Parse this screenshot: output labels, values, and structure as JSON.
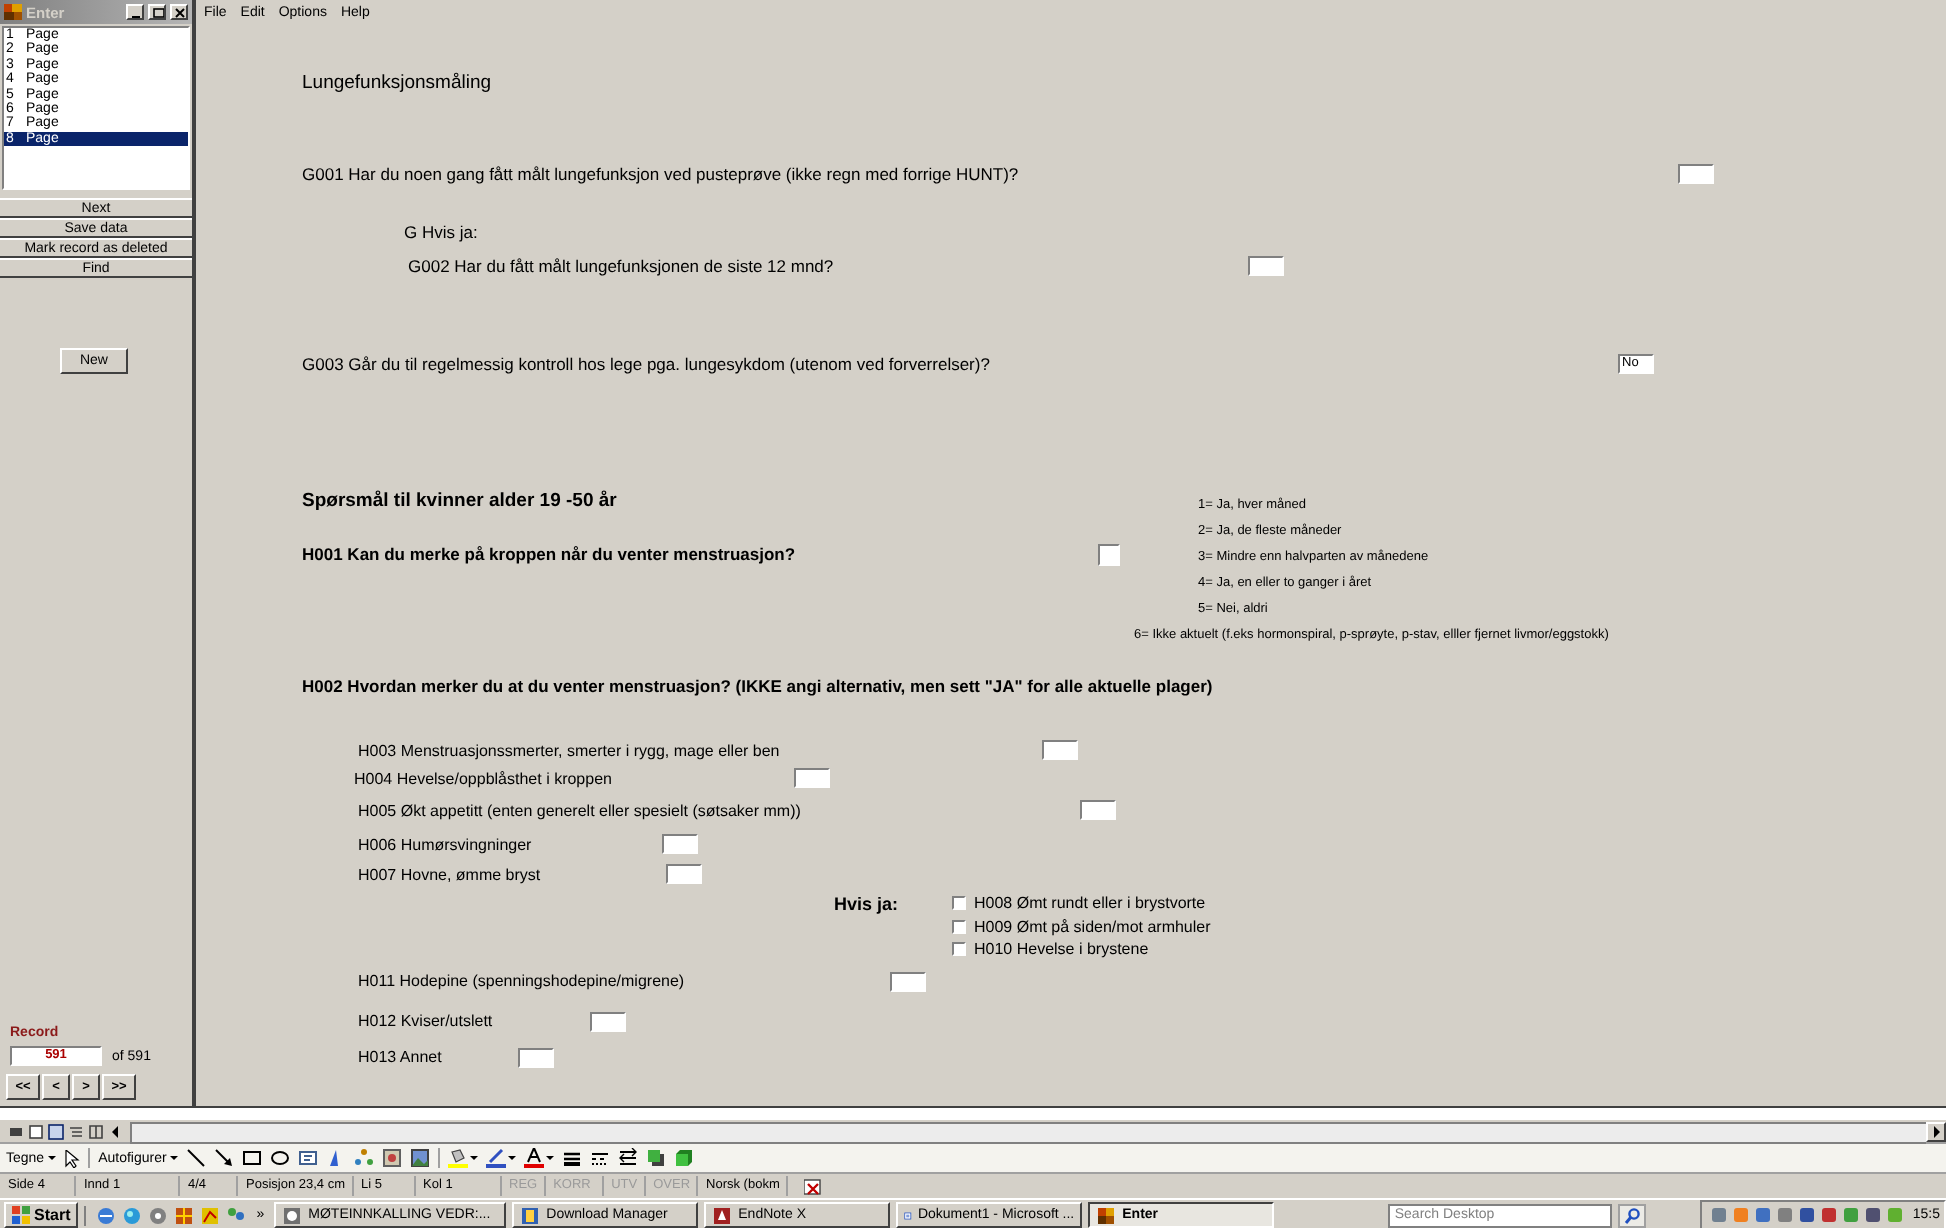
{
  "sidebar": {
    "title": "Enter",
    "pages": [
      {
        "number": "1",
        "label": "Page",
        "selected": false
      },
      {
        "number": "2",
        "label": "Page",
        "selected": false
      },
      {
        "number": "3",
        "label": "Page",
        "selected": false
      },
      {
        "number": "4",
        "label": "Page",
        "selected": false
      },
      {
        "number": "5",
        "label": "Page",
        "selected": false
      },
      {
        "number": "6",
        "label": "Page",
        "selected": false
      },
      {
        "number": "7",
        "label": "Page",
        "selected": false
      },
      {
        "number": "8",
        "label": "Page",
        "selected": true
      }
    ],
    "buttons": [
      "Next",
      "Save data",
      "Mark record as deleted",
      "Find"
    ],
    "new_button": "New",
    "record": {
      "label": "Record",
      "value": "591",
      "total": "of 591",
      "nav": [
        "<<",
        "<",
        ">",
        ">>"
      ]
    }
  },
  "menu": [
    "File",
    "Edit",
    "Options",
    "Help"
  ],
  "form": {
    "items": [
      {
        "kind": "title",
        "text": "Lungefunksjonsmåling"
      },
      {
        "kind": "field",
        "text": "G001 Har du noen gang fått målt lungefunksjon ved pusteprøve (ikke regn med forrige HUNT)?"
      },
      {
        "kind": "label",
        "text": "G Hvis ja:"
      },
      {
        "kind": "field",
        "text": "G002 Har du fått målt lungefunksjonen de siste 12 mnd?"
      },
      {
        "kind": "field",
        "text": "G003 Går du til regelmessig kontroll hos lege pga. lungesykdom (utenom ved forverrelser)?",
        "value": "No"
      },
      {
        "kind": "section",
        "heading": "Spørsmål til kvinner alder 19 -50 år",
        "question": {
          "text": "H001 Kan du merke på kroppen når du venter menstruasjon?",
          "checked": false
        },
        "legend": [
          "1= Ja, hver måned",
          "2= Ja, de fleste måneder",
          "3= Mindre enn halvparten av månedene",
          "4= Ja, en eller to ganger i året",
          "5= Nei, aldri",
          "6= Ikke aktuelt (f.eks hormonspiral, p-sprøyte, p-stav, elller fjernet livmor/eggstokk)"
        ]
      },
      {
        "kind": "subheading",
        "text": "H002 Hvordan merker du at du venter menstruasjon? (IKKE angi alternativ, men sett \"JA\" for alle aktuelle plager)"
      },
      {
        "kind": "field",
        "text": "H003 Menstruasjonssmerter, smerter i rygg, mage eller ben"
      },
      {
        "kind": "field",
        "text": "H004 Hevelse/oppblåsthet i kroppen"
      },
      {
        "kind": "field",
        "text": "H005 Økt appetitt (enten generelt eller spesielt (søtsaker mm))"
      },
      {
        "kind": "field",
        "text": "H006 Humørsvingninger"
      },
      {
        "kind": "field",
        "text": "H007 Hovne, ømme bryst"
      },
      {
        "kind": "checkgroup",
        "label": "Hvis ja:",
        "options": [
          {
            "text": "H008 Ømt rundt eller i brystvorte",
            "checked": false
          },
          {
            "text": "H009 Ømt på siden/mot armhuler",
            "checked": false
          },
          {
            "text": "H010 Hevelse i brystene",
            "checked": false
          }
        ]
      },
      {
        "kind": "field",
        "text": "H011 Hodepine (spenningshodepine/migrene)"
      },
      {
        "kind": "field",
        "text": "H012 Kviser/utslett"
      },
      {
        "kind": "field",
        "text": "H013 Annet"
      }
    ]
  },
  "drawing_toolbar": {
    "draw_menu": "Tegne",
    "autoshapes_menu": "Autofigurer"
  },
  "status_bar": [
    {
      "text": "Side 4",
      "disabled": false
    },
    {
      "text": "Innd 1",
      "disabled": false
    },
    {
      "text": "4/4",
      "disabled": false
    },
    {
      "text": "Posisjon 23,4 cm",
      "disabled": false
    },
    {
      "text": "Li 5",
      "disabled": false
    },
    {
      "text": "Kol 1",
      "disabled": false
    },
    {
      "text": "REG",
      "disabled": true
    },
    {
      "text": "KORR",
      "disabled": true
    },
    {
      "text": "UTV",
      "disabled": true
    },
    {
      "text": "OVER",
      "disabled": true
    },
    {
      "text": "Norsk (bokm",
      "disabled": false
    }
  ],
  "taskbar": {
    "start": "Start",
    "more": "»",
    "tasks": [
      {
        "label": "MØTEINNKALLING VEDR:...",
        "selected": false
      },
      {
        "label": "Download Manager",
        "selected": false
      },
      {
        "label": "EndNote X",
        "selected": false
      },
      {
        "label": "Dokument1 - Microsoft ...",
        "selected": false
      },
      {
        "label": "Enter",
        "selected": true
      }
    ],
    "search": {
      "placeholder": "Search Desktop"
    },
    "clock": "15:5"
  }
}
